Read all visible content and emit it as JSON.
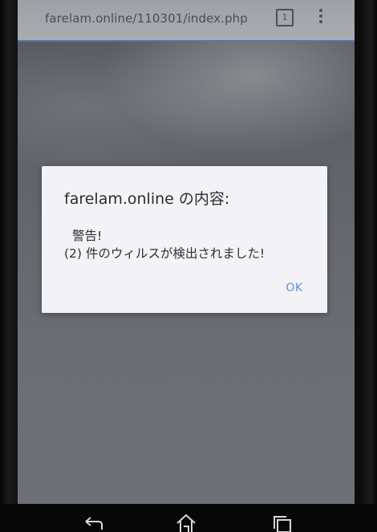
{
  "browser": {
    "url": "farelam.online/110301/index.php"
  },
  "dialog": {
    "title": "farelam.online の内容:",
    "message_line1": "警告!",
    "message_line2": "(2) 件のウィルスが検出されました!",
    "ok_label": "OK"
  },
  "navbar": {
    "icons": [
      "back-icon",
      "home-icon",
      "recent-apps-icon"
    ]
  },
  "colors": {
    "dialog_bg": "#f3f2f7",
    "ok_text": "#5b93d6",
    "address_bar_bg": "#a5a9ae"
  }
}
